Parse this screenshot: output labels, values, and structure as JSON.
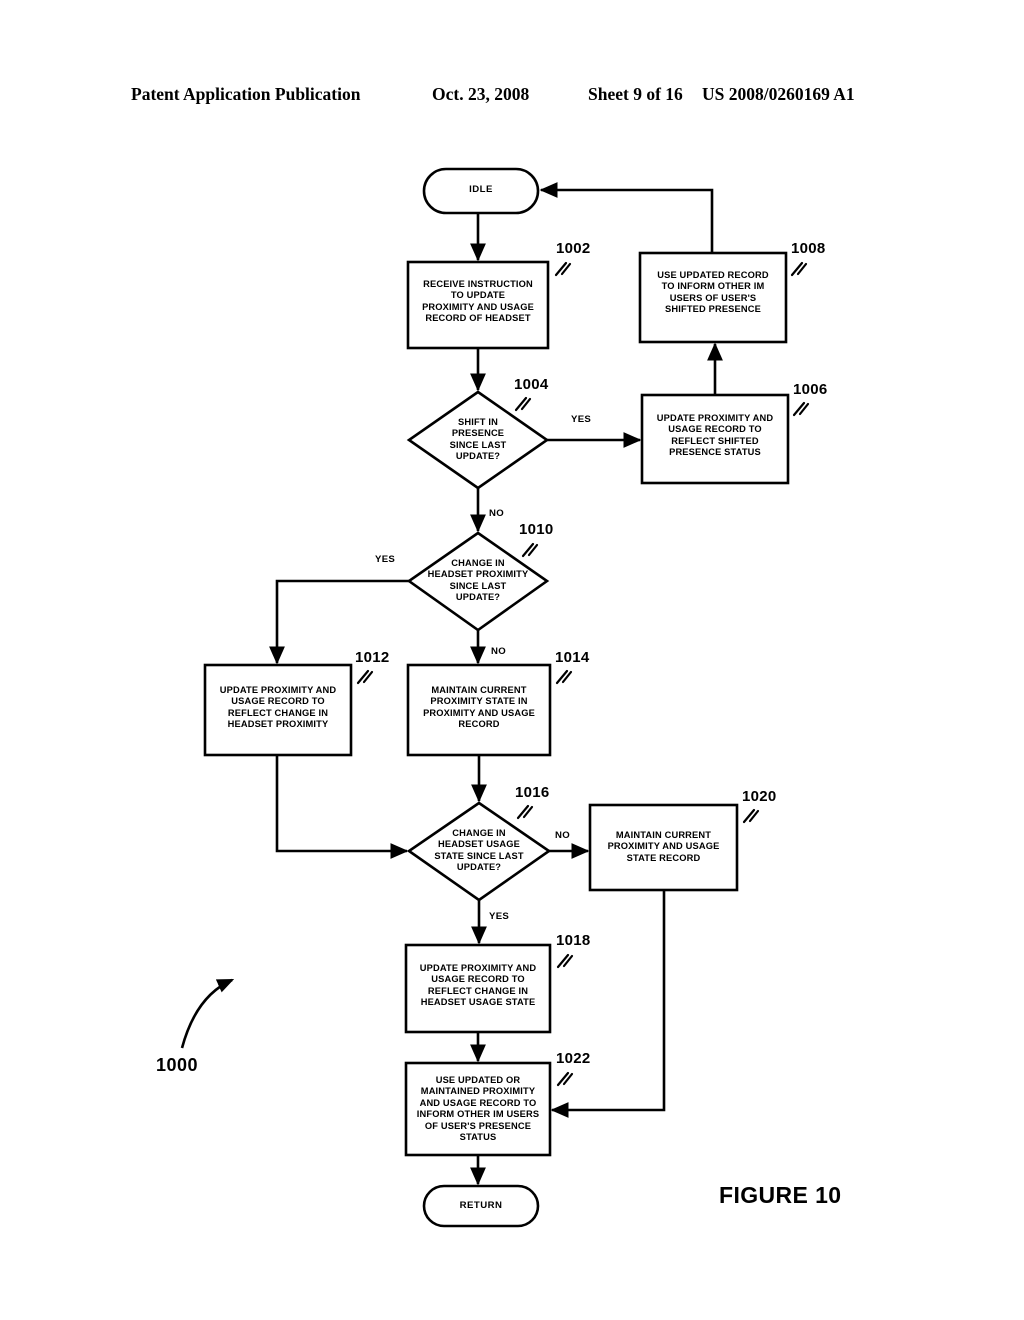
{
  "header": {
    "publication": "Patent Application Publication",
    "date": "Oct. 23, 2008",
    "sheet": "Sheet 9 of 16",
    "patent_number": "US 2008/0260169 A1"
  },
  "figure": {
    "caption": "FIGURE 10",
    "flow_number": "1000"
  },
  "nodes": {
    "idle": {
      "label": "IDLE",
      "shape": "terminator"
    },
    "n1002": {
      "ref": "1002",
      "shape": "process",
      "label": "RECEIVE INSTRUCTION\nTO UPDATE\nPROXIMITY AND  USAGE\nRECORD OF HEADSET"
    },
    "n1004": {
      "ref": "1004",
      "shape": "decision",
      "label": "SHIFT IN\nPRESENCE\nSINCE LAST\nUPDATE?"
    },
    "n1006": {
      "ref": "1006",
      "shape": "process",
      "label": "UPDATE PROXIMITY AND\nUSAGE RECORD TO\nREFLECT SHIFTED\nPRESENCE STATUS"
    },
    "n1008": {
      "ref": "1008",
      "shape": "process",
      "label": "USE UPDATED RECORD\nTO INFORM OTHER IM\nUSERS OF USER'S\nSHIFTED PRESENCE"
    },
    "n1010": {
      "ref": "1010",
      "shape": "decision",
      "label": "CHANGE IN\nHEADSET PROXIMITY\nSINCE LAST\nUPDATE?"
    },
    "n1012": {
      "ref": "1012",
      "shape": "process",
      "label": "UPDATE PROXIMITY AND\nUSAGE RECORD TO\nREFLECT CHANGE IN\nHEADSET PROXIMITY"
    },
    "n1014": {
      "ref": "1014",
      "shape": "process",
      "label": "MAINTAIN CURRENT\nPROXIMITY STATE IN\nPROXIMITY AND USAGE\nRECORD"
    },
    "n1016": {
      "ref": "1016",
      "shape": "decision",
      "label": "CHANGE IN\nHEADSET USAGE\nSTATE SINCE LAST\nUPDATE?"
    },
    "n1018": {
      "ref": "1018",
      "shape": "process",
      "label": "UPDATE PROXIMITY AND\nUSAGE RECORD TO\nREFLECT CHANGE IN\nHEADSET USAGE STATE"
    },
    "n1020": {
      "ref": "1020",
      "shape": "process",
      "label": "MAINTAIN CURRENT\nPROXIMITY AND USAGE\nSTATE RECORD"
    },
    "n1022": {
      "ref": "1022",
      "shape": "process",
      "label": "USE UPDATED OR\nMAINTAINED PROXIMITY\nAND USAGE RECORD TO\nINFORM OTHER IM USERS\nOF USER'S PRESENCE\nSTATUS"
    },
    "return": {
      "label": "RETURN",
      "shape": "terminator"
    }
  },
  "edge_labels": {
    "yes_1004": "YES",
    "no_1004": "NO",
    "yes_1010": "YES",
    "no_1010": "NO",
    "no_1016": "NO",
    "yes_1016": "YES"
  },
  "colors": {
    "stroke": "#000000",
    "background": "#ffffff",
    "text": "#000000"
  }
}
